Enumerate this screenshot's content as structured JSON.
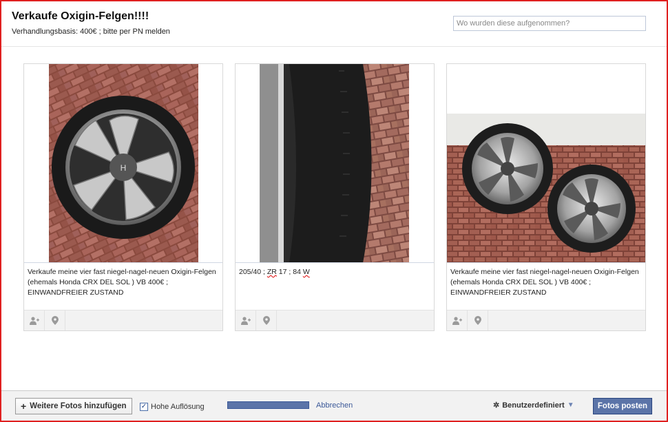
{
  "album": {
    "title": "Verkaufe Oxigin-Felgen!!!!",
    "description": "Verhandlungsbasis: 400€ ; bitte per PN melden",
    "location_placeholder": "Wo wurden diese aufgenommen?"
  },
  "photos": [
    {
      "caption": "Verkaufe meine vier fast niegel-nagel-neuen Oxigin-Felgen (ehemals Honda CRX DEL SOL ) VB 400€ ; EINWANDFREIER ZUSTAND",
      "tag_icon": "add-person-icon",
      "place_icon": "map-pin-icon"
    },
    {
      "caption_parts": [
        "205/40 ; ",
        "ZR",
        " 17 ; 84 ",
        "W"
      ],
      "tag_icon": "add-person-icon",
      "place_icon": "map-pin-icon"
    },
    {
      "caption": "Verkaufe meine vier fast niegel-nagel-neuen Oxigin-Felgen (ehemals Honda CRX DEL SOL ) VB 400€ ; EINWANDFREIER ZUSTAND",
      "tag_icon": "add-person-icon",
      "place_icon": "map-pin-icon"
    }
  ],
  "footer": {
    "add_more_label": "Weitere Fotos hinzufügen",
    "high_res_label": "Hohe Auflösung",
    "high_res_checked": true,
    "cancel_label": "Abbrechen",
    "privacy_label": "Benutzerdefiniert",
    "privacy_icon": "gear-icon",
    "post_label": "Fotos posten"
  },
  "colors": {
    "accent": "#3b5998",
    "button_blue": "#5b74a8",
    "frame_red": "#e02020"
  }
}
